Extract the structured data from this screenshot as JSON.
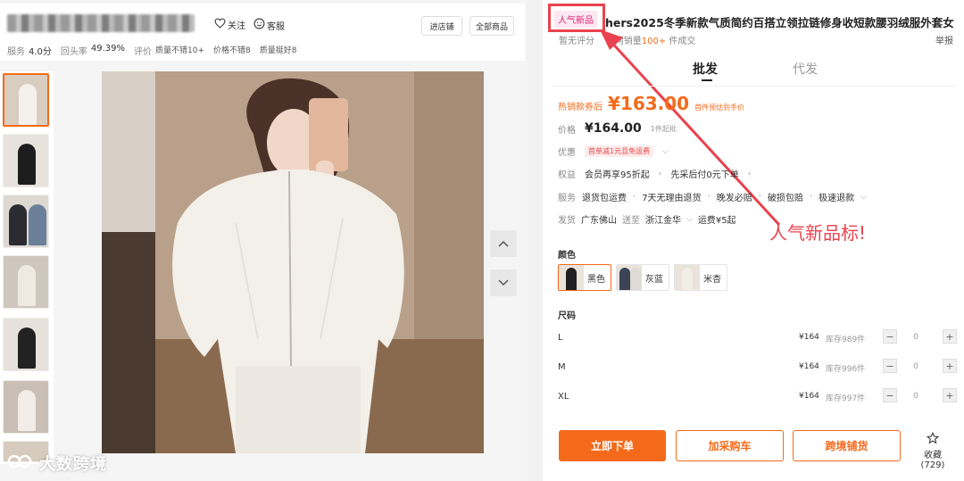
{
  "shop": {
    "follow_label": "关注",
    "service_label": "客服",
    "enter_shop": "进店铺",
    "all_products": "全部商品",
    "metrics": {
      "service_label": "服务",
      "service_value": "4.0分",
      "return_label": "回头率",
      "return_value": "49.39%",
      "review_label": "评价",
      "tags": [
        "质量不错10+",
        "价格不错8",
        "质量挺好8"
      ]
    }
  },
  "gallery": {
    "up_icon": "chevron-up-icon",
    "down_icon": "chevron-down-icon",
    "thumbnail_count": 7
  },
  "watermark": "大数跨境",
  "product": {
    "badge": "人气新品",
    "title": "hers2025冬季新款气质简约百搭立领拉链修身收短款腰羽绒服外套女",
    "rating_text": "暂无评分",
    "sales_prefix": "全网销量",
    "sales_value": "100+",
    "sales_suffix": "件成交",
    "report": "举报",
    "tabs": [
      "批发",
      "代发"
    ],
    "promo_label": "热销款券后",
    "promo_price": "¥163.00",
    "promo_note": "首件预估到手价",
    "price_label": "价格",
    "price_value": "¥164.00",
    "price_min": "1件起批",
    "discount_label": "优惠",
    "discount_coupon": "首单减1元且免运费",
    "rights_label": "权益",
    "rights_items": [
      "会员再享95折起",
      "先采后付0元下单"
    ],
    "service_label": "服务",
    "service_items": [
      "退货包运费",
      "7天无理由退货",
      "晚发必赔",
      "破损包赔",
      "极速退款"
    ],
    "ship_label": "发货",
    "ship_from": "广东佛山",
    "ship_to_word": "送至",
    "ship_to": "浙江金华",
    "ship_fee": "运费¥5起",
    "callout": "人气新品标!",
    "color_label": "颜色",
    "colors": [
      "黑色",
      "灰蓝",
      "米杏"
    ],
    "size_label": "尺码",
    "sizes": [
      {
        "name": "L",
        "price": "¥164",
        "stock": "库存989件",
        "qty": "0"
      },
      {
        "name": "M",
        "price": "¥164",
        "stock": "库存996件",
        "qty": "0"
      },
      {
        "name": "XL",
        "price": "¥164",
        "stock": "库存997件",
        "qty": "0"
      }
    ],
    "buy_now": "立即下单",
    "add_cart": "加采购车",
    "cross_border": "跨境铺货",
    "favorite_label": "收藏",
    "favorite_count": "(729)"
  },
  "colors": {
    "accent": "#f56a1a",
    "callout_red": "#e8434e",
    "badge_pink": "#e0247a"
  }
}
